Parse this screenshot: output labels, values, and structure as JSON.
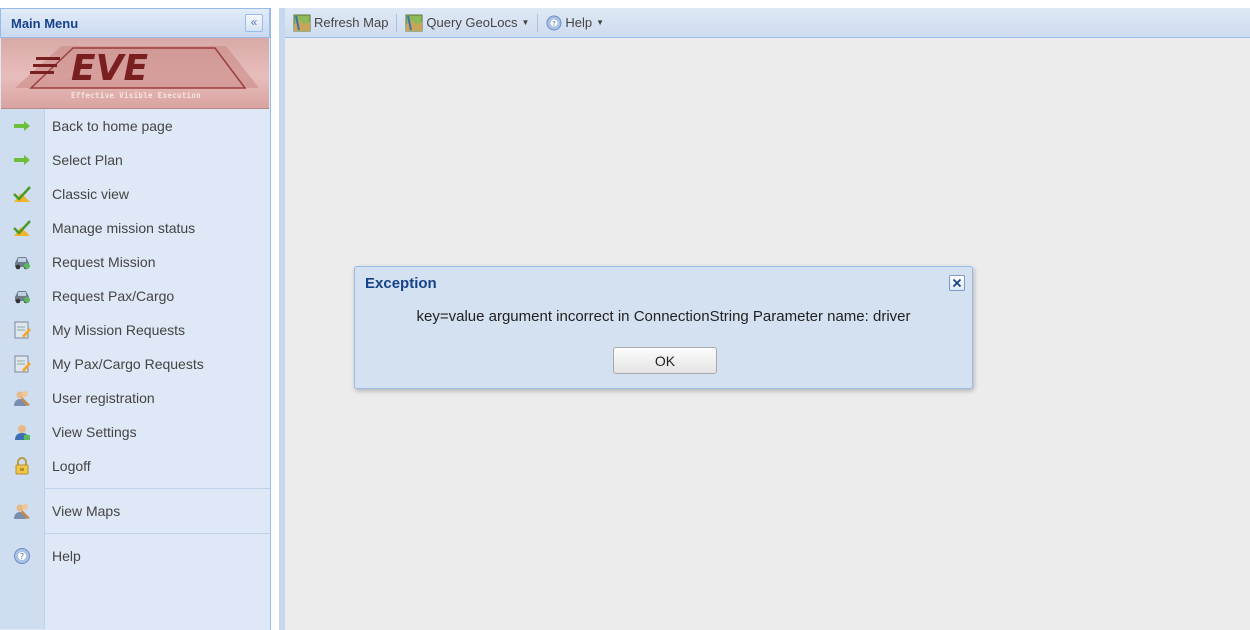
{
  "sidebar": {
    "title": "Main Menu",
    "collapse_icon": "double-chevron-left-icon",
    "logo_text": "EVE",
    "logo_tagline": "Effective Visible Execution",
    "items": [
      {
        "label": "Back to home page",
        "icon": "green-arrow-icon"
      },
      {
        "label": "Select Plan",
        "icon": "green-arrow-icon"
      },
      {
        "label": "Classic view",
        "icon": "check-warning-icon"
      },
      {
        "label": "Manage mission status",
        "icon": "check-warning-icon"
      },
      {
        "label": "Request Mission",
        "icon": "vehicle-icon"
      },
      {
        "label": "Request Pax/Cargo",
        "icon": "vehicle-icon"
      },
      {
        "label": "My Mission Requests",
        "icon": "notepad-icon"
      },
      {
        "label": "My Pax/Cargo Requests",
        "icon": "notepad-icon"
      },
      {
        "label": "User registration",
        "icon": "users-icon"
      },
      {
        "label": "View Settings",
        "icon": "user-settings-icon"
      },
      {
        "label": "Logoff",
        "icon": "lock-icon"
      },
      {
        "label": "View Maps",
        "icon": "users-icon"
      },
      {
        "label": "Help",
        "icon": "help-icon"
      }
    ]
  },
  "toolbar": {
    "refresh_label": "Refresh Map",
    "query_label": "Query GeoLocs",
    "help_label": "Help"
  },
  "dialog": {
    "title": "Exception",
    "message": "key=value argument incorrect in ConnectionString Parameter name: driver",
    "ok_label": "OK"
  },
  "colors": {
    "header_text": "#15428b",
    "panel_bg": "#dfe8f6",
    "border": "#99bbe8",
    "map_bg": "#ececec"
  }
}
